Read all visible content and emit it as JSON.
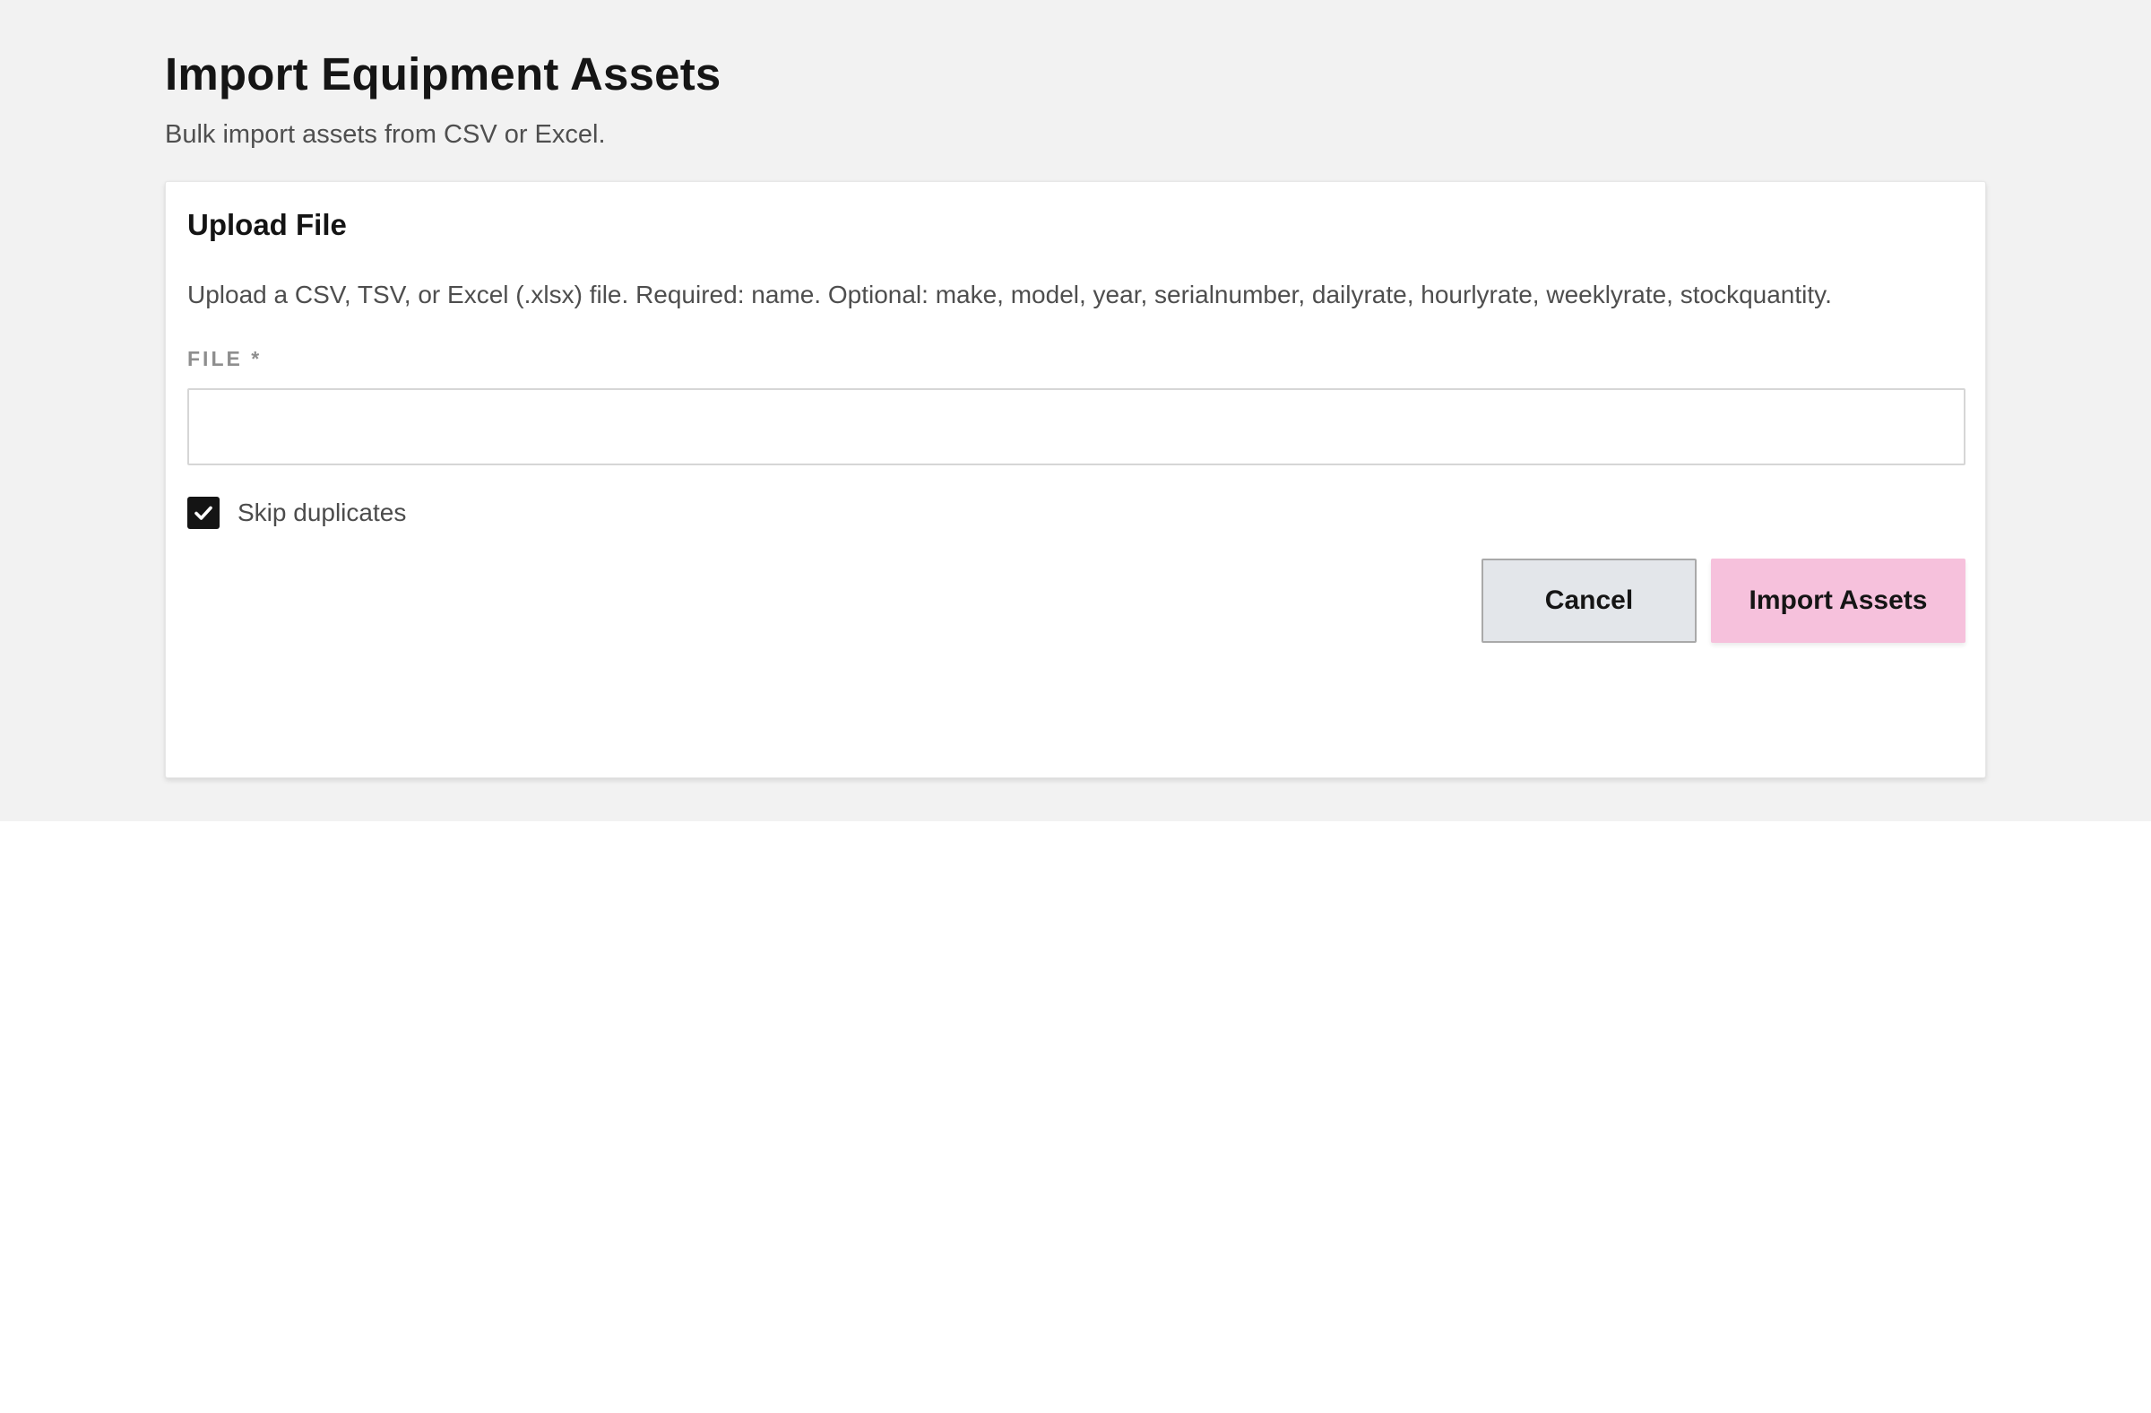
{
  "page": {
    "title": "Import Equipment Assets",
    "subtitle": "Bulk import assets from CSV or Excel."
  },
  "upload_card": {
    "title": "Upload File",
    "description": "Upload a CSV, TSV, or Excel (.xlsx) file. Required: name. Optional: make, model, year, serialnumber, dailyrate, hourlyrate, weeklyrate, stockquantity.",
    "file_field": {
      "label": "FILE *",
      "value": ""
    },
    "skip_duplicates": {
      "label": "Skip duplicates",
      "checked": true,
      "icon": "check-icon"
    },
    "actions": {
      "cancel_label": "Cancel",
      "import_label": "Import Assets"
    }
  },
  "colors": {
    "page_background": "#f2f2f2",
    "card_background": "#ffffff",
    "checkbox_checked": "#141414",
    "cancel_button": "#e3e6ea",
    "import_button": "#f6c1dc"
  }
}
